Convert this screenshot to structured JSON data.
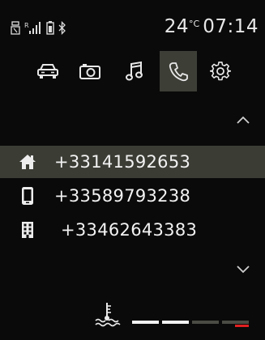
{
  "status": {
    "icons": [
      "bluetooth-adapter-icon",
      "signal-bars-icon",
      "battery-icon",
      "bluetooth-icon"
    ],
    "temperature_value": "24",
    "temperature_unit": "°C",
    "time": "07:14"
  },
  "nav": {
    "tabs": [
      {
        "name": "car",
        "icon": "car-icon",
        "active": false
      },
      {
        "name": "camera",
        "icon": "camera-icon",
        "active": false
      },
      {
        "name": "music",
        "icon": "music-note-icon",
        "active": false
      },
      {
        "name": "phone",
        "icon": "phone-icon",
        "active": true
      },
      {
        "name": "settings",
        "icon": "gear-icon",
        "active": false
      }
    ]
  },
  "phone_list": {
    "entries": [
      {
        "type": "home",
        "icon": "home-icon",
        "number": "+33141592653",
        "selected": true
      },
      {
        "type": "mobile",
        "icon": "mobile-phone-icon",
        "number": "+33589793238",
        "selected": false
      },
      {
        "type": "work",
        "icon": "office-building-icon",
        "number": "+33462643383",
        "selected": false
      }
    ]
  },
  "scroll": {
    "up_icon": "chevron-up-icon",
    "down_icon": "chevron-down-icon"
  },
  "bottom": {
    "coolant_icon": "coolant-temperature-icon",
    "gauge_segments": 5,
    "gauge_active_segments": 2,
    "colors": {
      "active": "#f2f2f2",
      "inactive": "#4a4c44",
      "warning": "#e02020"
    }
  },
  "colors": {
    "background": "#0a0a0a",
    "highlight": "#3b3d35",
    "text": "#f2f2f2"
  }
}
